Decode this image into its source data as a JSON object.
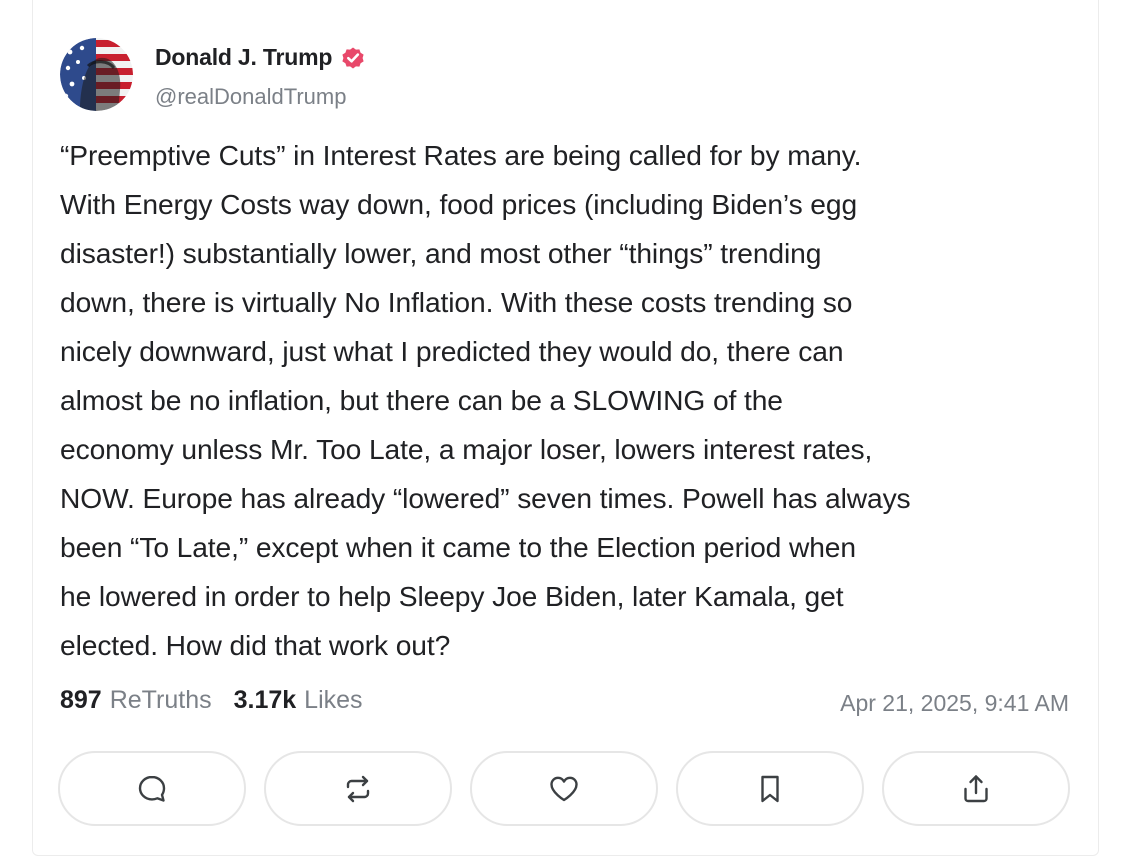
{
  "author": {
    "name": "Donald J. Trump",
    "handle": "@realDonaldTrump",
    "verified": true,
    "verified_color": "#e8486a"
  },
  "post": {
    "text": "“Preemptive Cuts” in Interest Rates are being called for by many.\nWith Energy Costs way down, food prices (including Biden’s egg\ndisaster!) substantially lower, and most other “things” trending\ndown, there is virtually No Inflation. With these costs trending so\nnicely downward, just what I predicted they would do, there can\nalmost be no inflation, but there can be a SLOWING of the\neconomy unless Mr. Too Late, a major loser, lowers interest rates,\nNOW. Europe has already “lowered” seven times. Powell has always\nbeen “To Late,” except when it came to the Election period when\nhe lowered in order to help Sleepy Joe Biden, later Kamala, get\nelected. How did that work out?"
  },
  "stats": {
    "retruths_count": "897",
    "retruths_label": "ReTruths",
    "likes_count": "3.17k",
    "likes_label": "Likes"
  },
  "timestamp": "Apr 21, 2025, 9:41 AM",
  "actions": [
    {
      "icon": "reply-icon"
    },
    {
      "icon": "retruth-icon"
    },
    {
      "icon": "heart-icon"
    },
    {
      "icon": "bookmark-icon"
    },
    {
      "icon": "share-icon"
    }
  ],
  "colors": {
    "text": "#202124",
    "muted": "#7b8087",
    "button_border": "#e6e6e6"
  }
}
